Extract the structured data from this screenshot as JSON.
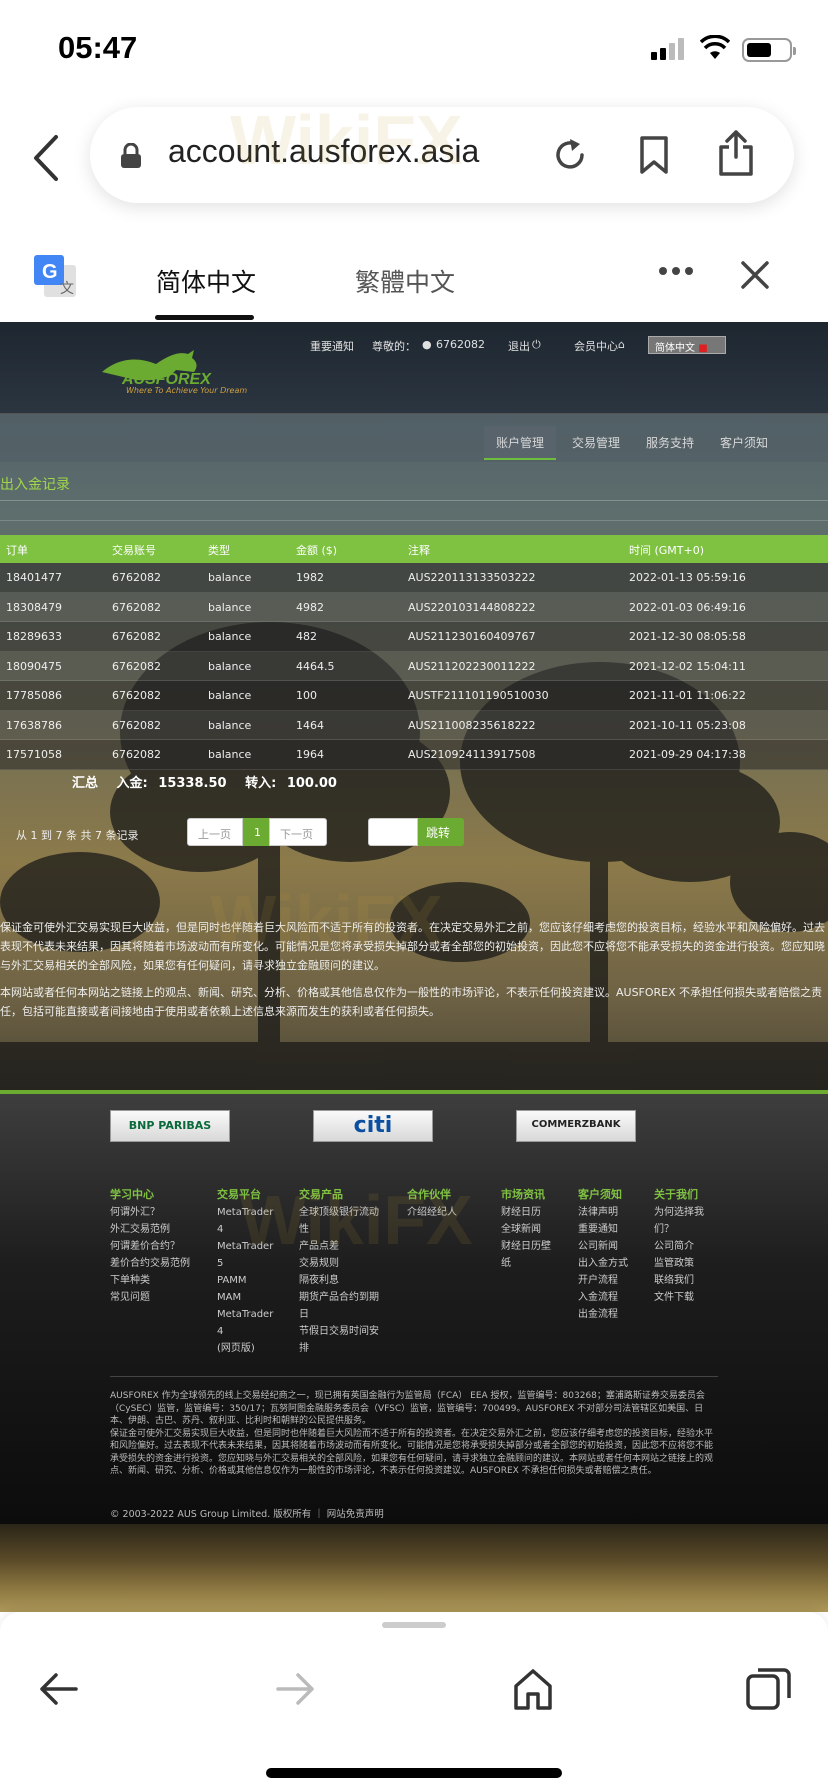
{
  "status": {
    "time": "05:47"
  },
  "browser": {
    "url": "account.ausforex.asia",
    "translate": {
      "tab_simplified": "简体中文",
      "tab_traditional": "繁體中文"
    }
  },
  "site": {
    "header": {
      "notice": "重要通知",
      "greeting": "尊敬的：",
      "user_id": "6762082",
      "logout": "退出",
      "member_center": "会员中心",
      "language": "简体中文",
      "logo_text": "AUSFOREX",
      "logo_tagline": "Where To Achieve Your Dream"
    },
    "subnav": [
      "账户管理",
      "交易管理",
      "服务支持",
      "客户须知"
    ],
    "records_title": "出入金记录",
    "table": {
      "headers": [
        "订单",
        "交易账号",
        "类型",
        "金额 ($)",
        "注释",
        "时间 (GMT+0)"
      ],
      "rows": [
        [
          "18401477",
          "6762082",
          "balance",
          "1982",
          "AUS220113133503222",
          "2022-01-13 05:59:16"
        ],
        [
          "18308479",
          "6762082",
          "balance",
          "4982",
          "AUS220103144808222",
          "2022-01-03 06:49:16"
        ],
        [
          "18289633",
          "6762082",
          "balance",
          "482",
          "AUS211230160409767",
          "2021-12-30 08:05:58"
        ],
        [
          "18090475",
          "6762082",
          "balance",
          "4464.5",
          "AUS211202230011222",
          "2021-12-02 15:04:11"
        ],
        [
          "17785086",
          "6762082",
          "balance",
          "100",
          "AUSTF211101190510030",
          "2021-11-01 11:06:22"
        ],
        [
          "17638786",
          "6762082",
          "balance",
          "1464",
          "AUS211008235618222",
          "2021-10-11 05:23:08"
        ],
        [
          "17571058",
          "6762082",
          "balance",
          "1964",
          "AUS210924113917508",
          "2021-09-29 04:17:38"
        ]
      ]
    },
    "summary": {
      "label": "汇总",
      "deposit_label": "入金:",
      "deposit": "15338.50",
      "transfer_label": "转入:",
      "transfer": "100.00"
    },
    "pagination": {
      "info": "从 1 到 7 条 共 7 条记录",
      "prev": "上一页",
      "current": "1",
      "next": "下一页",
      "jump": "跳转"
    },
    "disclaimer": [
      "保证金可使外汇交易实现巨大收益，但是同时也伴随着巨大风险而不适于所有的投资者。在决定交易外汇之前，您应该仔细考虑您的投资目标，经验水平和风险偏好。过去表现不代表未来结果，因其将随着市场波动而有所变化。可能情况是您将承受损失掉部分或者全部您的初始投资，因此您不应将您不能承受损失的资金进行投资。您应知晓与外汇交易相关的全部风险，如果您有任何疑问，请寻求独立金融顾问的建议。",
      "本网站或者任何本网站之链接上的观点、新闻、研究、分析、价格或其他信息仅作为一般性的市场评论，不表示任何投资建议。AUSFOREX 不承担任何损失或者赔偿之责任，包括可能直接或者间接地由于使用或者依赖上述信息来源而发生的获利或者任何损失。"
    ],
    "banks": [
      "BNP PARIBAS",
      "citi",
      "COMMERZBANK"
    ],
    "footer_cols": [
      {
        "title": "学习中心",
        "items": [
          "何谓外汇？",
          "外汇交易范例",
          "何谓差价合约？",
          "差价合约交易范例",
          "下单种类",
          "常见问题"
        ]
      },
      {
        "title": "交易平台",
        "items": [
          "MetaTrader",
          "4",
          "MetaTrader",
          "5",
          "PAMM",
          "MAM",
          "MetaTrader",
          "4",
          "(网页版)"
        ]
      },
      {
        "title": "交易产品",
        "items": [
          "全球顶级银行流动",
          "性",
          "产品点差",
          "交易规则",
          "隔夜利息",
          "期货产品合约到期",
          "日",
          "节假日交易时间安",
          "排"
        ]
      },
      {
        "title": "合作伙伴",
        "items": [
          "介绍经纪人"
        ]
      },
      {
        "title": "市场资讯",
        "items": [
          "财经日历",
          "全球新闻",
          "财经日历壁",
          "纸"
        ]
      },
      {
        "title": "客户须知",
        "items": [
          "法律声明",
          "重要通知",
          "公司新闻",
          "出入金方式",
          "开户流程",
          "入金流程",
          "出金流程"
        ]
      },
      {
        "title": "关于我们",
        "items": [
          "为何选择我",
          "们？",
          "公司简介",
          "监管政策",
          "联络我们",
          "文件下载"
        ]
      }
    ],
    "legal": [
      "AUSFOREX 作为全球领先的线上交易经纪商之一，现已拥有英国金融行为监管局（FCA） EEA 授权，监管编号：803268；塞浦路斯证券交易委员会（CySEC）监管，监管编号：350/17；瓦努阿图金融服务委员会（VFSC）监管，监管编号：700499。AUSFOREX 不对部分司法管辖区如美国、日本、伊朗、古巴、苏丹、叙利亚、比利时和朝鲜的公民提供服务。",
      "保证金可使外汇交易实现巨大收益，但是同时也伴随着巨大风险而不适于所有的投资者。在决定交易外汇之前，您应该仔细考虑您的投资目标，经验水平和风险偏好。过去表现不代表未来结果，因其将随着市场波动而有所变化。可能情况是您将承受损失掉部分或者全部您的初始投资，因此您不应将您不能承受损失的资金进行投资。您应知晓与外汇交易相关的全部风险，如果您有任何疑问，请寻求独立金融顾问的建议。本网站或者任何本网站之链接上的观点、新闻、研究、分析、价格或其他信息仅作为一般性的市场评论，不表示任何投资建议。AUSFOREX 不承担任何损失或者赔偿之责任。"
    ],
    "copyright": "© 2003-2022 AUS Group Limited. 版权所有 ｜ 网站免责声明"
  },
  "colors": {
    "accent_green": "#7fc241",
    "header_dark": "#1e2730"
  },
  "icons": [
    "back-icon",
    "lock-icon",
    "reload-icon",
    "bookmark-icon",
    "share-icon",
    "google-translate-icon",
    "more-icon",
    "close-icon",
    "nav-back-icon",
    "nav-forward-icon",
    "home-icon",
    "tabs-icon"
  ]
}
